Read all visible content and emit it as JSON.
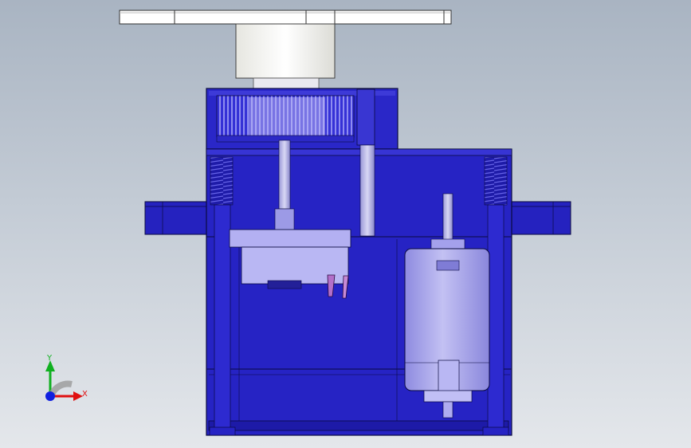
{
  "viewport": {
    "background_top": "#a9b4c2",
    "background_bottom": "#e4e7eb"
  },
  "model": {
    "parts": [
      "servo-horn",
      "output-hub",
      "upper-gear-cover",
      "output-gear",
      "main-housing",
      "mounting-flange-left",
      "mounting-flange-right",
      "potentiometer",
      "dc-motor",
      "screw-post-left",
      "screw-post-right"
    ],
    "colors": {
      "housing_fill": "#2d2ad0",
      "housing_dark": "#1d1aa8",
      "housing_edge": "#0a0a40",
      "internal_part": "#a9a6ef",
      "horn_white": "#ffffff",
      "hub_white": "#f7f7f2"
    }
  },
  "triad": {
    "x_label": "X",
    "y_label": "Y",
    "x_color": "#e01010",
    "y_color": "#10b020",
    "z_color": "#1020e0"
  }
}
